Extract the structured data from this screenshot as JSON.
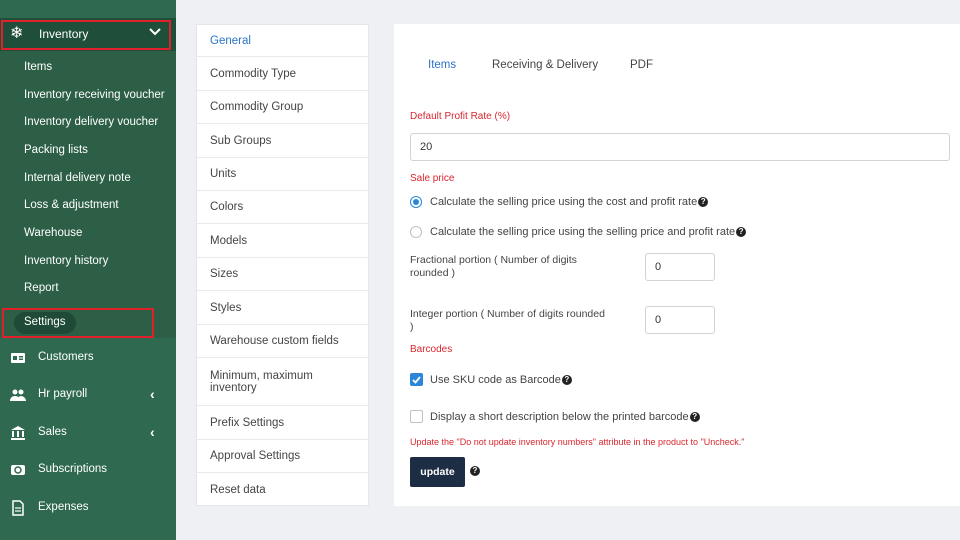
{
  "sidebar": {
    "inventory_label": "Inventory",
    "sub_items": [
      {
        "label": "Items"
      },
      {
        "label": "Inventory receiving voucher"
      },
      {
        "label": "Inventory delivery voucher"
      },
      {
        "label": "Packing lists"
      },
      {
        "label": "Internal delivery note"
      },
      {
        "label": "Loss & adjustment"
      },
      {
        "label": "Warehouse"
      },
      {
        "label": "Inventory history"
      },
      {
        "label": "Report"
      }
    ],
    "settings_label": "Settings",
    "nav": [
      {
        "label": "Customers",
        "icon": "id-card-icon"
      },
      {
        "label": "Hr payroll",
        "icon": "users-icon"
      },
      {
        "label": "Sales",
        "icon": "bank-icon"
      },
      {
        "label": "Subscriptions",
        "icon": "refresh-icon"
      },
      {
        "label": "Expenses",
        "icon": "file-icon"
      }
    ]
  },
  "submenu": {
    "items": [
      {
        "label": "General"
      },
      {
        "label": "Commodity Type"
      },
      {
        "label": "Commodity Group"
      },
      {
        "label": "Sub Groups"
      },
      {
        "label": "Units"
      },
      {
        "label": "Colors"
      },
      {
        "label": "Models"
      },
      {
        "label": "Sizes"
      },
      {
        "label": "Styles"
      },
      {
        "label": "Warehouse custom fields"
      },
      {
        "label": "Minimum, maximum inventory"
      },
      {
        "label": "Prefix Settings"
      },
      {
        "label": "Approval Settings"
      },
      {
        "label": "Reset data"
      }
    ]
  },
  "panel": {
    "tabs": [
      {
        "label": "Items"
      },
      {
        "label": "Receiving & Delivery"
      },
      {
        "label": "PDF"
      }
    ],
    "profit_rate_label": "Default Profit Rate (%)",
    "profit_rate_value": "20",
    "sale_price_label": "Sale price",
    "radio_cost": "Calculate the selling price using the cost and profit rate",
    "radio_selling": "Calculate the selling price using the selling price and profit rate",
    "fractional_label_1": "Fractional portion ( Number of digits",
    "fractional_label_2": "rounded )",
    "fractional_value": "0",
    "integer_label_1": "Integer portion ( Number of digits rounded",
    "integer_label_2": ")",
    "integer_value": "0",
    "barcodes_label": "Barcodes",
    "sku_checkbox": "Use SKU code as Barcode",
    "short_desc_checkbox": "Display a short description below the printed barcode",
    "update_note": "Update the \"Do not update inventory numbers\" attribute in the product to \"Uncheck.\"",
    "update_button": "update"
  },
  "colors": {
    "sidebar": "#2f6a50",
    "accent": "#2b73c7",
    "highlight": "#e0202a",
    "button": "#1d2d44"
  }
}
